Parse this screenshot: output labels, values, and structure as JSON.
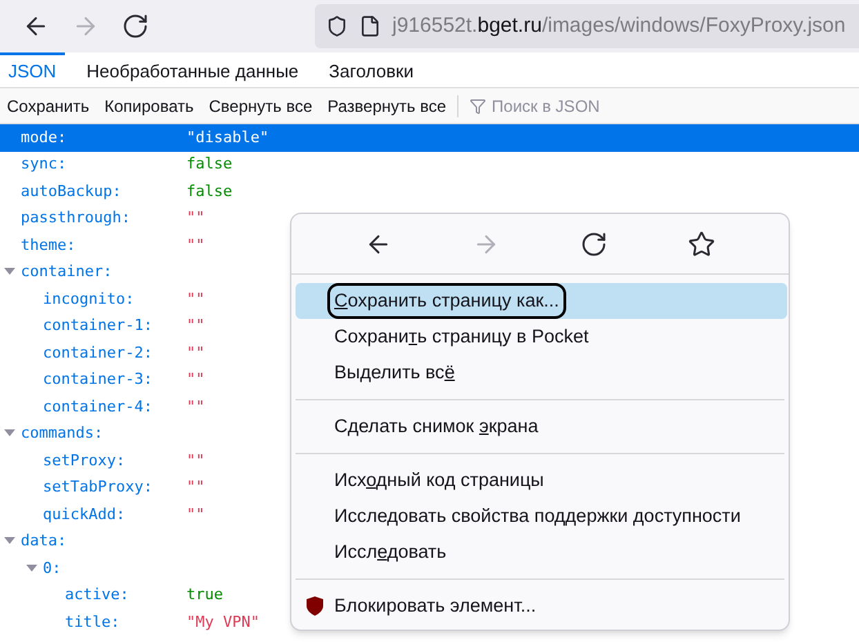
{
  "browser_toolbar": {
    "nav_buttons": [
      {
        "kind": "back",
        "disabled": false
      },
      {
        "kind": "forward",
        "disabled": true
      },
      {
        "kind": "reload",
        "disabled": false
      }
    ],
    "url": {
      "prefix": "j916552t.",
      "host": "bget.ru",
      "path": "/images/windows/FoxyProxy.json"
    }
  },
  "tabs": [
    {
      "label": "JSON",
      "selected": true
    },
    {
      "label": "Необработанные данные",
      "selected": false
    },
    {
      "label": "Заголовки",
      "selected": false
    }
  ],
  "toolbar": {
    "buttons": [
      "Сохранить",
      "Копировать",
      "Свернуть все",
      "Развернуть все"
    ],
    "filter": {
      "placeholder": "Поиск в JSON"
    }
  },
  "tree": [
    {
      "key": "mode:",
      "value": "\"disable\"",
      "selected": true
    },
    {
      "key": "sync:",
      "value": "false",
      "kind": "boolean",
      "selected": false
    },
    {
      "key": "autoBackup:",
      "value": "false",
      "kind": "boolean",
      "selected": false
    },
    {
      "key": "passthrough:",
      "value": "\"\"",
      "kind": "string",
      "selected": false
    },
    {
      "key": "theme:",
      "value": "\"\"",
      "kind": "string",
      "selected": false
    },
    {
      "key": "container:",
      "selected": false,
      "expanded": true,
      "children": [
        {
          "key": "incognito:",
          "value": "\"\"",
          "kind": "string",
          "selected": false
        },
        {
          "key": "container-1:",
          "value": "\"\"",
          "kind": "string",
          "selected": false
        },
        {
          "key": "container-2:",
          "value": "\"\"",
          "kind": "string",
          "selected": false
        },
        {
          "key": "container-3:",
          "value": "\"\"",
          "kind": "string",
          "selected": false
        },
        {
          "key": "container-4:",
          "value": "\"\"",
          "kind": "string",
          "selected": false
        }
      ]
    },
    {
      "key": "commands:",
      "selected": false,
      "expanded": true,
      "children": [
        {
          "key": "setProxy:",
          "value": "\"\"",
          "kind": "string",
          "selected": false
        },
        {
          "key": "setTabProxy:",
          "value": "\"\"",
          "kind": "string",
          "selected": false
        },
        {
          "key": "quickAdd:",
          "value": "\"\"",
          "kind": "string",
          "selected": false
        }
      ]
    },
    {
      "key": "data:",
      "selected": false,
      "expanded": true,
      "children": [
        {
          "key": "0:",
          "selected": false,
          "expanded": true,
          "children": [
            {
              "key": "active:",
              "value": "true",
              "kind": "boolean",
              "selected": false
            },
            {
              "key": "title:",
              "value": "\"My VPN\"",
              "kind": "string",
              "selected": false
            }
          ]
        }
      ]
    }
  ],
  "context_menu": {
    "nav_buttons": [
      {
        "kind": "back",
        "disabled": false
      },
      {
        "kind": "forward",
        "disabled": true
      },
      {
        "kind": "reload",
        "disabled": false
      },
      {
        "kind": "bookmark",
        "disabled": false
      }
    ],
    "items": [
      {
        "kind": "item",
        "access_key": "С",
        "after": "охранить страницу как...",
        "selected": true,
        "circled": true
      },
      {
        "kind": "item",
        "before": "Сохрани",
        "access_key": "т",
        "after": "ь страницу в Pocket",
        "selected": false,
        "circled": false
      },
      {
        "kind": "item",
        "before": "Выделить вс",
        "access_key": "ё",
        "selected": false,
        "circled": false
      },
      {
        "kind": "separator"
      },
      {
        "kind": "item",
        "before": "Сделать снимок ",
        "access_key": "э",
        "after": "крана",
        "selected": false,
        "circled": false
      },
      {
        "kind": "separator"
      },
      {
        "kind": "item",
        "before": "Исх",
        "access_key": "о",
        "after": "дный код страницы",
        "selected": false,
        "circled": false
      },
      {
        "kind": "item",
        "before": "Исследовать свойства поддержки доступности",
        "selected": false,
        "circled": false
      },
      {
        "kind": "item",
        "before": "Иссл",
        "access_key": "е",
        "after": "довать",
        "selected": false,
        "circled": false
      },
      {
        "kind": "separator"
      },
      {
        "kind": "extension_item",
        "before": "Блокировать элемент...",
        "selected": false,
        "circled": false
      }
    ]
  }
}
